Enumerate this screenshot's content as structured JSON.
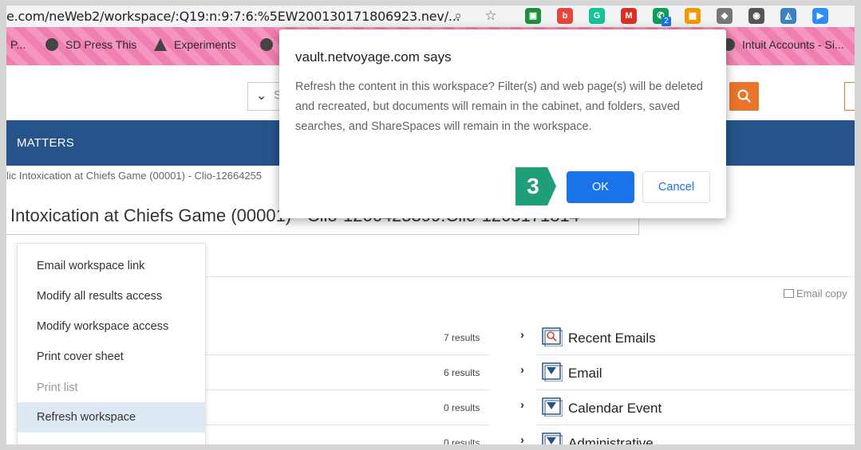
{
  "browser": {
    "url": "e.com/neWeb2/workspace/:Q19:n:9:7:6:%5EW200130171806923.nev/...",
    "extensions": [
      {
        "name": "robot-extension-icon",
        "color": "#1e8e3e",
        "label": "▣"
      },
      {
        "name": "b-extension-icon",
        "color": "#e8453c",
        "label": "b"
      },
      {
        "name": "grammarly-icon",
        "color": "#15c39a",
        "label": "G"
      },
      {
        "name": "gmail-icon",
        "color": "#d93025",
        "label": "M"
      },
      {
        "name": "phone-extension-icon",
        "color": "#0f9d58",
        "label": "✆"
      },
      {
        "name": "grid-extension-icon",
        "color": "#f29900",
        "label": "▦"
      },
      {
        "name": "drive-extension-icon",
        "color": "#777777",
        "label": "◆"
      },
      {
        "name": "eye-slash-extension-icon",
        "color": "#555555",
        "label": "◉"
      },
      {
        "name": "bird-extension-icon",
        "color": "#3b82c4",
        "label": "◭"
      },
      {
        "name": "zoom-extension-icon",
        "color": "#2d8cff",
        "label": "▶"
      }
    ],
    "ext_badge": "2"
  },
  "bookmarks": [
    {
      "label": "P..."
    },
    {
      "label": "SD Press This"
    },
    {
      "label": "Experiments"
    },
    {
      "label": ""
    },
    {
      "label": "Intuit Accounts - Si..."
    }
  ],
  "nav": {
    "label": "MATTERS"
  },
  "breadcrumb": "lic Intoxication at Chiefs Game (00001) - Clio-12664255",
  "workspace_title": "Intoxication at Chiefs Game (00001) - Clio-1266425399:Clio-1205171814",
  "menu": {
    "items": [
      {
        "label": "Email workspace link"
      },
      {
        "label": "Modify all results access"
      },
      {
        "label": "Modify workspace access"
      },
      {
        "label": "Print cover sheet"
      },
      {
        "label": "Print list"
      },
      {
        "label": "Refresh workspace"
      }
    ]
  },
  "email_copy": "Email copy",
  "results": [
    {
      "count": "7 results",
      "folder": "Recent Emails"
    },
    {
      "count": "6 results",
      "folder": "Email"
    },
    {
      "count": "0 results",
      "folder": "Calendar Event"
    },
    {
      "count": "0 results",
      "folder": "Administrative"
    }
  ],
  "dialog": {
    "title": "vault.netvoyage.com says",
    "message": "Refresh the content in this workspace? Filter(s) and web page(s) will be deleted and recreated, but documents will remain in the cabinet, and folders, saved searches, and ShareSpaces will remain in the workspace.",
    "ok_label": "OK",
    "cancel_label": "Cancel",
    "step_number": "3"
  },
  "colors": {
    "navbar": "#26548a",
    "accent_orange": "#e8752a",
    "ok_blue": "#1a73e8",
    "step_green": "#1f9e7a"
  }
}
